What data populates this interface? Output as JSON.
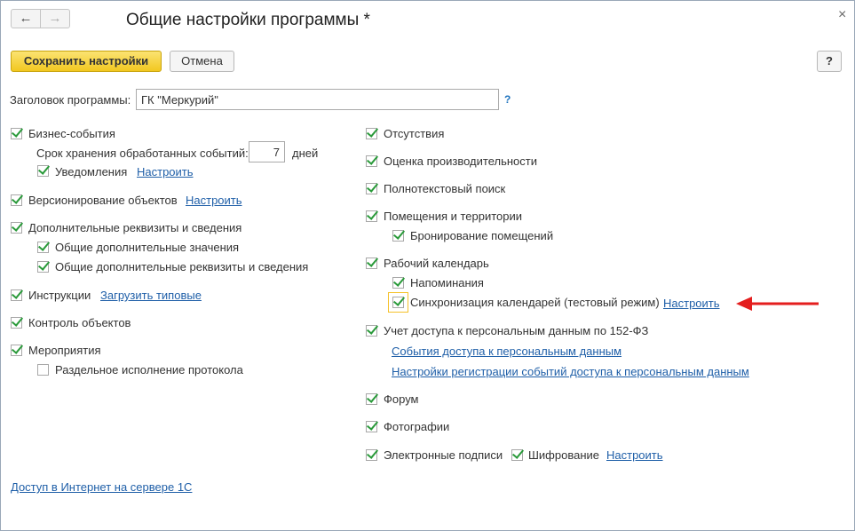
{
  "window": {
    "title": "Общие настройки программы *"
  },
  "toolbar": {
    "save_label": "Сохранить настройки",
    "cancel_label": "Отмена",
    "help_label": "?"
  },
  "header_field": {
    "label": "Заголовок программы:",
    "value": "ГК \"Меркурий\"",
    "help": "?"
  },
  "left": {
    "business_events": "Бизнес-события",
    "retention_label": "Срок хранения обработанных событий:",
    "retention_value": "7",
    "retention_unit": "дней",
    "notifications": "Уведомления",
    "notifications_link": "Настроить",
    "versioning": "Версионирование объектов",
    "versioning_link": "Настроить",
    "extra_props": "Дополнительные реквизиты и сведения",
    "common_values": "Общие дополнительные значения",
    "common_props": "Общие дополнительные реквизиты и сведения",
    "instructions": "Инструкции",
    "instructions_link": "Загрузить типовые",
    "object_control": "Контроль объектов",
    "events": "Мероприятия",
    "separate_protocol": "Раздельное исполнение протокола",
    "internet_link": "Доступ в Интернет на сервере 1С"
  },
  "right": {
    "absences": "Отсутствия",
    "performance": "Оценка производительности",
    "fulltext": "Полнотекстовый поиск",
    "premises": "Помещения и территории",
    "booking": "Бронирование помещений",
    "work_calendar": "Рабочий календарь",
    "reminders": "Напоминания",
    "calendar_sync": "Синхронизация календарей (тестовый режим)",
    "calendar_sync_link": "Настроить",
    "personal_data": "Учет доступа к персональным данным по 152-ФЗ",
    "pd_events_link": "События доступа к персональным данным",
    "pd_settings_link": "Настройки регистрации событий доступа к персональным данным",
    "forum": "Форум",
    "photos": "Фотографии",
    "signatures": "Электронные подписи",
    "encryption": "Шифрование",
    "signatures_link": "Настроить"
  },
  "colors": {
    "accent": "#f2c820",
    "check": "#2a9a3a",
    "link": "#1f5fa8",
    "arrow": "#e41e1e"
  }
}
